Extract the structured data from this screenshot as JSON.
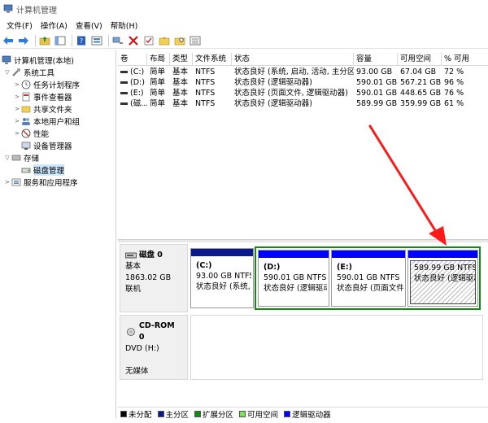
{
  "window": {
    "title": "计算机管理"
  },
  "menu": [
    "文件(F)",
    "操作(A)",
    "查看(V)",
    "帮助(H)"
  ],
  "toolbar": [
    "back-icon",
    "forward-icon",
    "up-folder-icon",
    "console-tree-icon",
    "help-icon",
    "properties-icon",
    "connect-icon",
    "delete-icon",
    "check-icon",
    "open-folder-icon",
    "search-folder-icon",
    "list-view-icon"
  ],
  "tree": {
    "root": "计算机管理(本地)",
    "system_tools": "系统工具",
    "task_scheduler": "任务计划程序",
    "event_viewer": "事件查看器",
    "shared_folders": "共享文件夹",
    "local_users": "本地用户和组",
    "performance": "性能",
    "device_manager": "设备管理器",
    "storage": "存储",
    "disk_management": "磁盘管理",
    "services_apps": "服务和应用程序"
  },
  "table": {
    "headers": [
      "卷",
      "布局",
      "类型",
      "文件系统",
      "状态",
      "容量",
      "可用空间",
      "% 可用"
    ],
    "rows": [
      [
        "(C:)",
        "简单",
        "基本",
        "NTFS",
        "状态良好 (系统, 启动, 活动, 主分区)",
        "93.00 GB",
        "67.04 GB",
        "72 %"
      ],
      [
        "(D:)",
        "简单",
        "基本",
        "NTFS",
        "状态良好 (逻辑驱动器)",
        "590.01 GB",
        "567.21 GB",
        "96 %"
      ],
      [
        "(E:)",
        "简单",
        "基本",
        "NTFS",
        "状态良好 (页面文件, 逻辑驱动器)",
        "590.01 GB",
        "448.65 GB",
        "76 %"
      ],
      [
        "(磁...",
        "简单",
        "基本",
        "NTFS",
        "状态良好 (逻辑驱动器)",
        "589.99 GB",
        "359.99 GB",
        "61 %"
      ]
    ]
  },
  "disk0": {
    "name": "磁盘 0",
    "type": "基本",
    "size": "1863.02 GB",
    "status": "联机",
    "partitions": [
      {
        "name": "(C:)",
        "size": "93.00 GB NTFS",
        "status": "状态良好 (系统, 启"
      },
      {
        "name": "(D:)",
        "size": "590.01 GB NTFS",
        "status": "状态良好 (逻辑驱动器"
      },
      {
        "name": "(E:)",
        "size": "590.01 GB NTFS",
        "status": "状态良好 (页面文件,"
      },
      {
        "name": "",
        "size": "589.99 GB NTFS",
        "status": "状态良好 (逻辑驱动器"
      }
    ]
  },
  "cdrom0": {
    "name": "CD-ROM 0",
    "type": "DVD (H:)",
    "status": "无媒体"
  },
  "legend": [
    "未分配",
    "主分区",
    "扩展分区",
    "可用空间",
    "逻辑驱动器"
  ],
  "colors": {
    "primary": "#0a1a8c",
    "logical": "#0000ff",
    "extended": "#118a11",
    "free": "#7ddf5a",
    "unallocated": "#000000",
    "arrow": "#ff1a1a",
    "selection": "#cce8ff"
  }
}
